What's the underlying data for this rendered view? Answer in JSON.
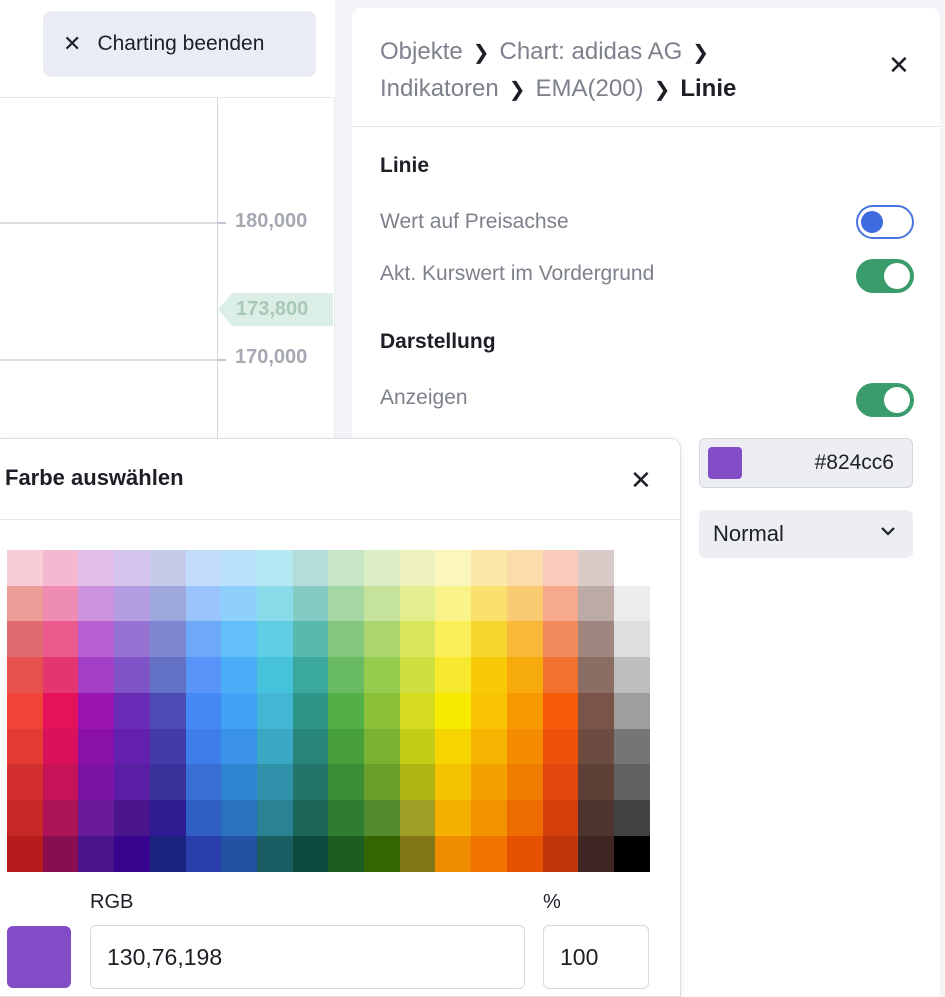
{
  "toolbar": {
    "exit_label": "Charting beenden",
    "exit_icon": "close-icon"
  },
  "chart": {
    "ticks": [
      "180,000",
      "170,000"
    ],
    "current_price": "173,800",
    "current_price_color": "#dcefe6"
  },
  "panel": {
    "breadcrumb": [
      {
        "label": "Objekte"
      },
      {
        "label": "Chart: adidas AG"
      },
      {
        "label": "Indikatoren"
      },
      {
        "label": "EMA(200)"
      },
      {
        "label": "Linie"
      }
    ],
    "section_line": "Linie",
    "opt_value_axis": "Wert auf Preisachse",
    "opt_value_axis_on": false,
    "opt_foreground": "Akt. Kurswert im Vordergrund",
    "opt_foreground_on": true,
    "section_display": "Darstellung",
    "opt_show": "Anzeigen",
    "opt_show_on": true,
    "color_hex": "#824cc6",
    "line_style": "Normal"
  },
  "picker": {
    "title": "Farbe auswählen",
    "rgb_label": "RGB",
    "rgb_value": "130,76,198",
    "percent_label": "%",
    "percent_value": "100",
    "selected_color": "#824cc6",
    "palette": [
      [
        "#f8cdd6",
        "#f4b8d0",
        "#e2bfe9",
        "#d3c5ec",
        "#c6cbea",
        "#c2dcfc",
        "#b8e1fb",
        "#b4e8f2",
        "#b2ddd8",
        "#c7e6c8",
        "#ddedc4",
        "#eef3bd",
        "#fbf7bc",
        "#fce7a8",
        "#fcdcab",
        "#f9cbba",
        "#d8cbc8",
        null
      ],
      [
        "#ec9b97",
        "#ef8cb3",
        "#cd92dd",
        "#b49ce1",
        "#9fa8dc",
        "#9ac4fb",
        "#8ed0f9",
        "#89dbea",
        "#85cbc3",
        "#a5d7a4",
        "#c6e39c",
        "#e3ef8f",
        "#faf38a",
        "#fae06c",
        "#facb72",
        "#f6a98b",
        "#bbaaa6",
        "#ececec"
      ],
      [
        "#e06c70",
        "#ea5a8d",
        "#b760d2",
        "#9673d3",
        "#7d88d1",
        "#6ea8f9",
        "#63bff8",
        "#5fcde3",
        "#57b8ad",
        "#82c680",
        "#abd66f",
        "#d8e75b",
        "#f9ef58",
        "#f8d42f",
        "#f8b93a",
        "#f38a5b",
        "#9f867f",
        "#dedede"
      ],
      [
        "#e5524e",
        "#e5356e",
        "#a33fc5",
        "#7e54c6",
        "#6472c6",
        "#5994f8",
        "#49aef7",
        "#47c2db",
        "#3aa89c",
        "#69bb63",
        "#96cc4e",
        "#cde040",
        "#f6e92e",
        "#f7c909",
        "#f7aa0c",
        "#f1712f",
        "#8a6e66",
        "#bebebe"
      ],
      [
        "#f04436",
        "#e4125a",
        "#9914b0",
        "#6a2bb6",
        "#4d4ab3",
        "#4488f5",
        "#42a1f5",
        "#42b6d4",
        "#2d9686",
        "#52b044",
        "#8bc138",
        "#d6dd20",
        "#f9eb00",
        "#f8c300",
        "#f69800",
        "#f45a07",
        "#7a5449",
        "#9e9e9e"
      ],
      [
        "#e43b32",
        "#d9105a",
        "#8911a9",
        "#631fae",
        "#433ca8",
        "#3f7de8",
        "#3a93e6",
        "#3aa8c2",
        "#278679",
        "#47a03c",
        "#7cb232",
        "#c3cd17",
        "#f6d400",
        "#f6b300",
        "#f48b00",
        "#ec5009",
        "#6c4b41",
        "#757575"
      ],
      [
        "#d32f2f",
        "#c61256",
        "#7d13a2",
        "#5a1ea4",
        "#3a329b",
        "#376fd6",
        "#2f84d2",
        "#2f92aa",
        "#217569",
        "#3b8e33",
        "#68a028",
        "#adb612",
        "#f4c200",
        "#f3a100",
        "#ef7d00",
        "#e2470e",
        "#5d4038",
        "#616161"
      ],
      [
        "#c62828",
        "#ad1457",
        "#6a1b9a",
        "#4a148c",
        "#311b92",
        "#2f5fc2",
        "#2a72be",
        "#2a8292",
        "#1b6559",
        "#2e7d32",
        "#558b2f",
        "#9e9d24",
        "#f3b000",
        "#f29200",
        "#ec6c00",
        "#d63f0a",
        "#4d342f",
        "#424242"
      ],
      [
        "#b71c1c",
        "#880e4f",
        "#4a148c",
        "#38038f",
        "#1a237e",
        "#2a3eab",
        "#2352a3",
        "#1a5d63",
        "#0f4a3e",
        "#1b5e20",
        "#336601",
        "#827717",
        "#ef8c00",
        "#f27400",
        "#e65100",
        "#bf360c",
        "#3e2723",
        "#000000"
      ]
    ]
  }
}
